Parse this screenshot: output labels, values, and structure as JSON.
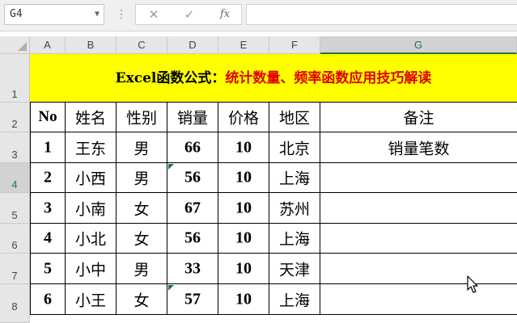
{
  "namebox": {
    "value": "G4"
  },
  "formula_bar": {
    "cancel_icon": "✕",
    "enter_icon": "✓",
    "fx_label": "fx",
    "value": ""
  },
  "columns": [
    "A",
    "B",
    "C",
    "D",
    "E",
    "F",
    "G"
  ],
  "rows": [
    "1",
    "2",
    "3",
    "4",
    "5",
    "6",
    "7",
    "8"
  ],
  "title": {
    "part1": "Excel函数公式：",
    "part2": "统计数量、频率函数应用技巧解读"
  },
  "table": {
    "headers": [
      "No",
      "姓名",
      "性别",
      "销量",
      "价格",
      "地区",
      "备注"
    ],
    "data": [
      [
        "1",
        "王东",
        "男",
        "66",
        "10",
        "北京",
        "销量笔数"
      ],
      [
        "2",
        "小西",
        "男",
        "56",
        "10",
        "上海",
        ""
      ],
      [
        "3",
        "小南",
        "女",
        "67",
        "10",
        "苏州",
        ""
      ],
      [
        "4",
        "小北",
        "女",
        "56",
        "10",
        "上海",
        ""
      ],
      [
        "5",
        "小中",
        "男",
        "33",
        "10",
        "天津",
        ""
      ],
      [
        "6",
        "小王",
        "女",
        "57",
        "10",
        "上海",
        ""
      ]
    ]
  },
  "colors": {
    "title_bg": "#ffff00",
    "title_red": "#e00000",
    "accent": "#217346"
  }
}
